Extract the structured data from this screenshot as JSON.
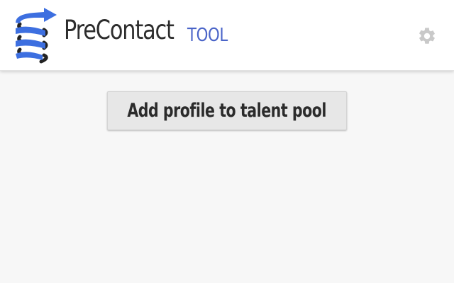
{
  "header": {
    "logo": {
      "main_text": "PreContact",
      "sub_text": "TOOL",
      "icon": "spiral-arrow-icon"
    },
    "settings_icon": "gear-icon"
  },
  "main": {
    "add_button_label": "Add profile to talent pool"
  },
  "colors": {
    "brand_blue": "#3d6fe0",
    "brand_dark": "#2d2d2d",
    "button_bg": "#e7e7e7",
    "page_bg": "#f7f7f7",
    "settings_gray": "#c9c9c9"
  }
}
